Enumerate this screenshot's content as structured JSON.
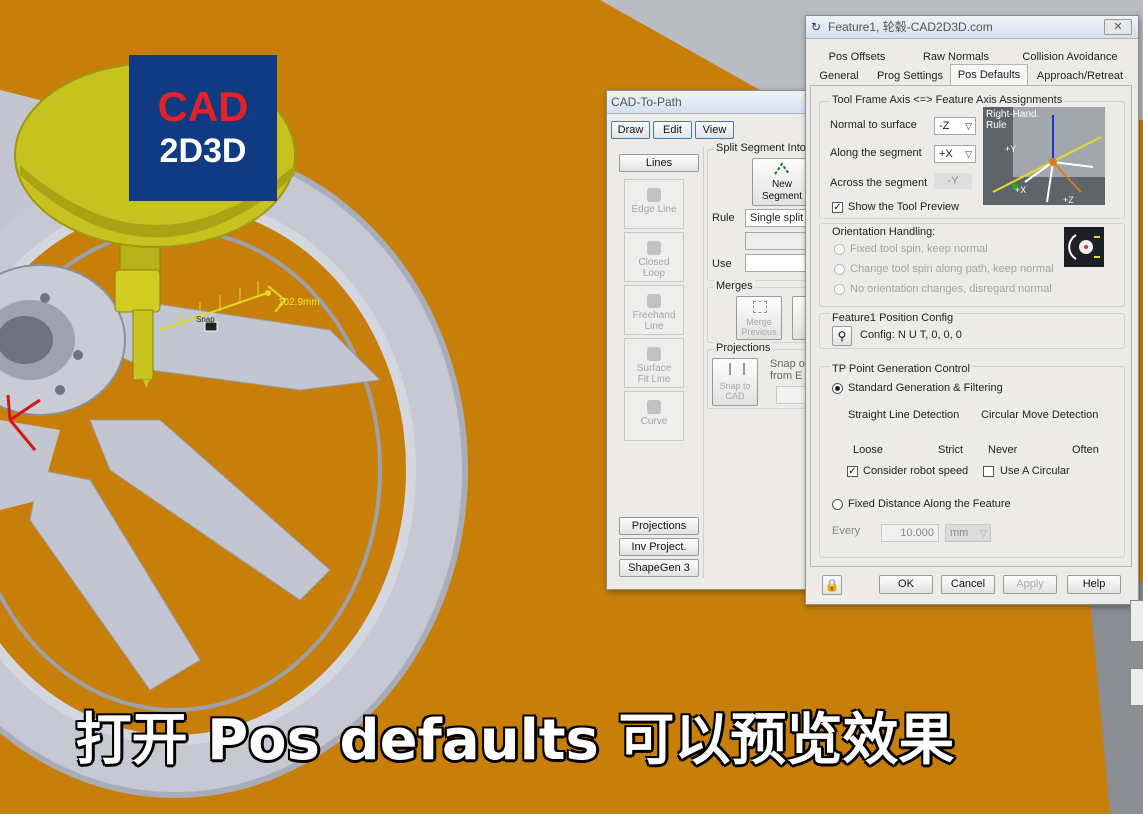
{
  "logo": {
    "line1": "CAD",
    "line2": "2D3D"
  },
  "viewport": {
    "dimension_label": "102.9mm",
    "marker_label": "Snap"
  },
  "subtitle": "打开 Pos defaults 可以预览效果",
  "cad_to_path": {
    "title": "CAD-To-Path",
    "menu": [
      "Draw",
      "Edit",
      "View"
    ],
    "lines_button": "Lines",
    "side_tools": [
      {
        "label": "Edge Line"
      },
      {
        "label": "Closed Loop"
      },
      {
        "label": "Freehand Line"
      },
      {
        "label": "Surface Fit Line"
      },
      {
        "label": "Curve"
      }
    ],
    "bottom_buttons": [
      "Projections",
      "Inv Project.",
      "ShapeGen 3"
    ],
    "split_segment": {
      "title": "Split Segment Into:",
      "new_segment_line1": "New",
      "new_segment_line2": "Segment",
      "rule_label": "Rule",
      "rule_value": "Single split",
      "use_label": "Use"
    },
    "merges": {
      "title": "Merges",
      "merge_previous_line1": "Merge",
      "merge_previous_line2": "Previous"
    },
    "projections": {
      "title": "Projections",
      "snap_to_cad_line1": "Snap to",
      "snap_to_cad_line2": "CAD",
      "snap_from_line1": "Snap o",
      "snap_from_line2": "from E"
    }
  },
  "feature_dialog": {
    "title": "Feature1, 轮毂-CAD2D3D.com",
    "tabs_row1": [
      "Pos Offsets",
      "Raw Normals",
      "Collision Avoidance"
    ],
    "tabs_row2": [
      "General",
      "Prog Settings",
      "Pos Defaults",
      "Approach/Retreat"
    ],
    "active_tab": "Pos Defaults",
    "tool_frame": {
      "title": "Tool Frame Axis <=> Feature Axis Assignments",
      "normal_label": "Normal to surface",
      "normal_value": "-Z",
      "along_label": "Along the segment",
      "along_value": "+X",
      "across_label": "Across the segment",
      "across_value": "-Y",
      "show_preview_label": "Show the Tool Preview",
      "show_preview_checked": true,
      "preview": {
        "rule_line1": "Right-Hand",
        "rule_line2": "Rule",
        "plus_y": "+Y",
        "plus_x": "+X",
        "plus_z": "+Z"
      }
    },
    "orientation": {
      "title": "Orientation Handling:",
      "options": [
        "Fixed tool spin, keep normal",
        "Change tool spin along path, keep normal",
        "No orientation changes, disregard normal"
      ]
    },
    "position_config": {
      "title": "Feature1 Position Config",
      "config_text": "Config: N U T, 0, 0, 0"
    },
    "tp_generation": {
      "title": "TP Point Generation Control",
      "standard_label": "Standard Generation & Filtering",
      "straight_label": "Straight Line Detection",
      "circular_label": "Circular Move Detection",
      "loose": "Loose",
      "strict": "Strict",
      "never": "Never",
      "often": "Often",
      "consider_speed_label": "Consider robot speed",
      "consider_speed_checked": true,
      "use_circular_label": "Use A Circular",
      "use_circular_checked": false,
      "fixed_distance_label": "Fixed Distance Along the Feature",
      "every_label": "Every",
      "every_value": "10.000",
      "every_unit": "mm"
    },
    "buttons": {
      "ok": "OK",
      "cancel": "Cancel",
      "apply": "Apply",
      "help": "Help"
    }
  },
  "colors": {
    "background": "#c77f0a",
    "wheel": "#c3c6d0",
    "tool_yellow": "#c8c21e",
    "logo_blue": "#103a82",
    "logo_red": "#e32127"
  }
}
